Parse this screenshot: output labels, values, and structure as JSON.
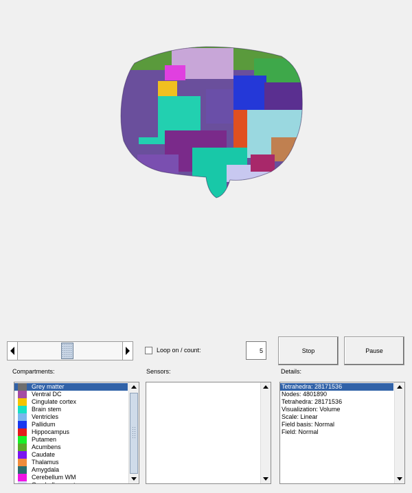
{
  "controls": {
    "slider_value": 0.47,
    "loop_label": "Loop on / count:",
    "loop_checked": false,
    "count_value": "5",
    "stop_label": "Stop",
    "pause_label": "Pause"
  },
  "labels": {
    "compartments": "Compartments:",
    "sensors": "Sensors:",
    "details": "Details:"
  },
  "compartments": [
    {
      "name": "Grey matter",
      "color": "#6e6e6e",
      "selected": true
    },
    {
      "name": "Ventral DC",
      "color": "#a44ca4"
    },
    {
      "name": "Cingulate cortex",
      "color": "#f4c400"
    },
    {
      "name": "Brain stem",
      "color": "#18e0c4"
    },
    {
      "name": "Ventricles",
      "color": "#7ab6ee"
    },
    {
      "name": "Pallidum",
      "color": "#1838f0"
    },
    {
      "name": "Hippocampus",
      "color": "#e41c1c"
    },
    {
      "name": "Putamen",
      "color": "#18f028"
    },
    {
      "name": "Acumbens",
      "color": "#5aa828"
    },
    {
      "name": "Caudate",
      "color": "#7a14f0"
    },
    {
      "name": "Thalamus",
      "color": "#f08c3c"
    },
    {
      "name": "Amygdala",
      "color": "#2a6e6e"
    },
    {
      "name": "Cerebellum WM",
      "color": "#f014e4"
    },
    {
      "name": "Cerebellum cortex",
      "color": "#d8d8f8"
    }
  ],
  "details": [
    {
      "text": "Tetrahedra: 28171536",
      "selected": true
    },
    {
      "text": "Nodes: 4801890"
    },
    {
      "text": "Tetrahedra: 28171536"
    },
    {
      "text": "Visualization: Volume"
    },
    {
      "text": "Scale: Linear"
    },
    {
      "text": "Field basis: Normal"
    },
    {
      "text": "Field: Normal"
    }
  ]
}
